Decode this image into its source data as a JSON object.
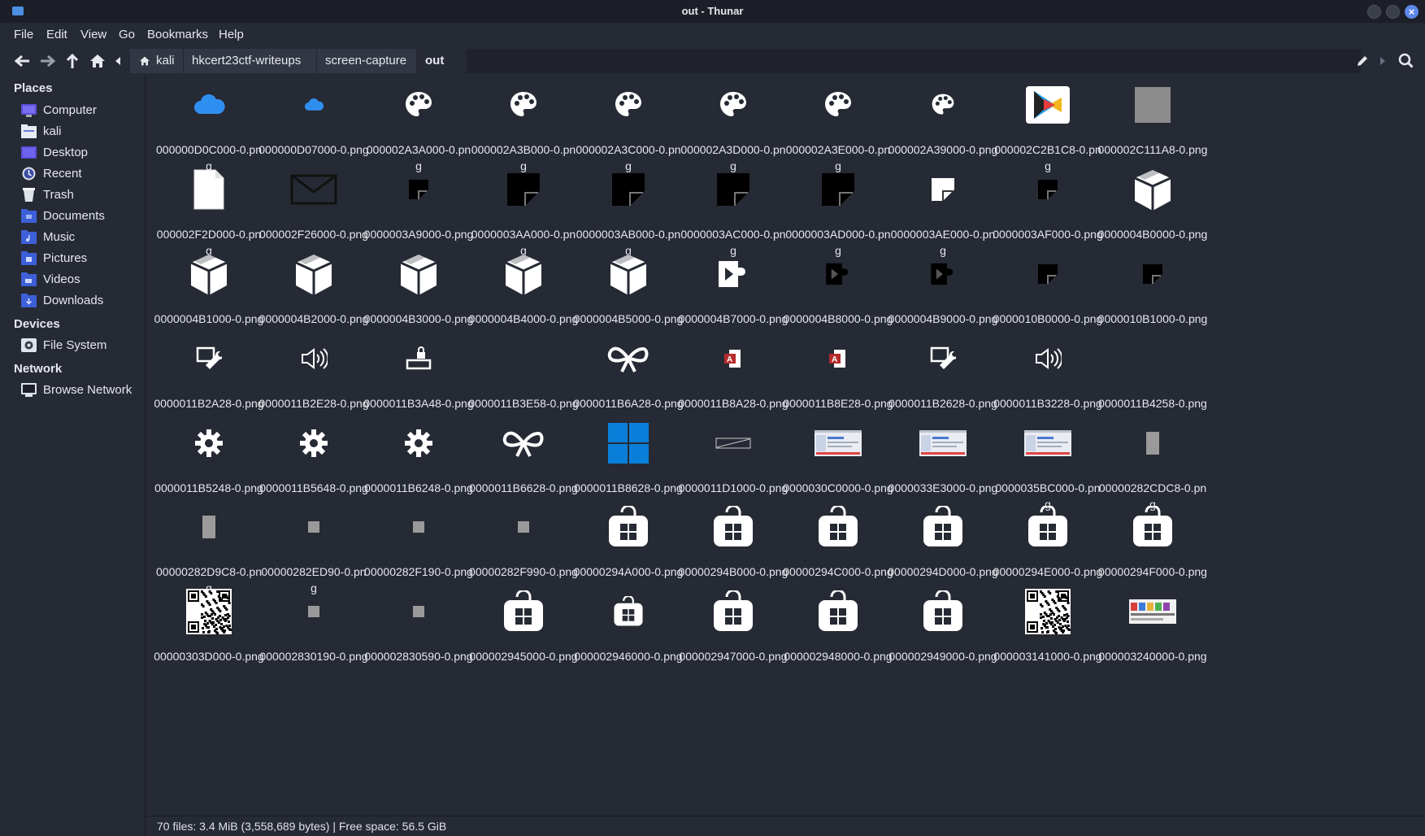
{
  "window": {
    "title": "out - Thunar"
  },
  "menu": [
    "File",
    "Edit",
    "View",
    "Go",
    "Bookmarks",
    "Help"
  ],
  "breadcrumbs": [
    "kali",
    "hkcert23ctf-writeups",
    "screen-capture",
    "out"
  ],
  "sidebar": {
    "places_label": "Places",
    "places": [
      {
        "label": "Computer",
        "icon": "computer-icon"
      },
      {
        "label": "kali",
        "icon": "home-folder-icon"
      },
      {
        "label": "Desktop",
        "icon": "desktop-icon"
      },
      {
        "label": "Recent",
        "icon": "recent-icon"
      },
      {
        "label": "Trash",
        "icon": "trash-icon"
      },
      {
        "label": "Documents",
        "icon": "documents-folder-icon"
      },
      {
        "label": "Music",
        "icon": "music-folder-icon"
      },
      {
        "label": "Pictures",
        "icon": "pictures-folder-icon"
      },
      {
        "label": "Videos",
        "icon": "videos-folder-icon"
      },
      {
        "label": "Downloads",
        "icon": "downloads-folder-icon"
      }
    ],
    "devices_label": "Devices",
    "devices": [
      {
        "label": "File System",
        "icon": "drive-icon"
      }
    ],
    "network_label": "Network",
    "network": [
      {
        "label": "Browse Network",
        "icon": "network-icon"
      }
    ]
  },
  "files": [
    {
      "name": "000000D0C000-0.png",
      "icon": "cloud-icon"
    },
    {
      "name": "000000D07000-0.png",
      "icon": "cloud-small-icon"
    },
    {
      "name": "000002A3A000-0.png",
      "icon": "palette-icon"
    },
    {
      "name": "000002A3B000-0.png",
      "icon": "palette-icon"
    },
    {
      "name": "000002A3C000-0.png",
      "icon": "palette-icon"
    },
    {
      "name": "000002A3D000-0.png",
      "icon": "palette-icon"
    },
    {
      "name": "000002A3E000-0.png",
      "icon": "palette-icon"
    },
    {
      "name": "000002A39000-0.png",
      "icon": "palette-small-icon"
    },
    {
      "name": "000002C2B1C8-0.png",
      "icon": "play-store-icon"
    },
    {
      "name": "000002C111A8-0.png",
      "icon": "gray-square-icon"
    },
    {
      "name": "000002F2D000-0.png",
      "icon": "blank-document-icon"
    },
    {
      "name": "000002F26000-0.png",
      "icon": "envelope-icon"
    },
    {
      "name": "0000003A9000-0.png",
      "icon": "note-small-icon"
    },
    {
      "name": "0000003AA000-0.png",
      "icon": "note-icon"
    },
    {
      "name": "0000003AB000-0.png",
      "icon": "note-icon"
    },
    {
      "name": "0000003AC000-0.png",
      "icon": "note-icon"
    },
    {
      "name": "0000003AD000-0.png",
      "icon": "note-icon"
    },
    {
      "name": "0000003AE000-0.png",
      "icon": "note-white-icon"
    },
    {
      "name": "0000003AF000-0.png",
      "icon": "note-small-icon"
    },
    {
      "name": "0000004B0000-0.png",
      "icon": "package-icon"
    },
    {
      "name": "0000004B1000-0.png",
      "icon": "package-icon"
    },
    {
      "name": "0000004B2000-0.png",
      "icon": "package-icon"
    },
    {
      "name": "0000004B3000-0.png",
      "icon": "package-icon"
    },
    {
      "name": "0000004B4000-0.png",
      "icon": "package-icon"
    },
    {
      "name": "0000004B5000-0.png",
      "icon": "package-icon"
    },
    {
      "name": "0000004B7000-0.png",
      "icon": "media-puzzle-icon"
    },
    {
      "name": "0000004B8000-0.png",
      "icon": "media-puzzle-dark-icon"
    },
    {
      "name": "0000004B9000-0.png",
      "icon": "media-puzzle-dark-icon"
    },
    {
      "name": "0000010B0000-0.png",
      "icon": "note-small-icon"
    },
    {
      "name": "0000010B1000-0.png",
      "icon": "note-small-icon"
    },
    {
      "name": "0000011B2A28-0.png",
      "icon": "settings-wrench-icon"
    },
    {
      "name": "0000011B2E28-0.png",
      "icon": "speaker-icon"
    },
    {
      "name": "0000011B3A48-0.png",
      "icon": "lock-keyboard-icon"
    },
    {
      "name": "0000011B3E58-0.png",
      "icon": "empty-icon"
    },
    {
      "name": "0000011B6A28-0.png",
      "icon": "accessibility-icon"
    },
    {
      "name": "0000011B8A28-0.png",
      "icon": "access-app-icon"
    },
    {
      "name": "0000011B8E28-0.png",
      "icon": "access-app-icon"
    },
    {
      "name": "0000011B2628-0.png",
      "icon": "settings-wrench-icon"
    },
    {
      "name": "0000011B3228-0.png",
      "icon": "speaker-icon"
    },
    {
      "name": "0000011B4258-0.png",
      "icon": "empty-icon"
    },
    {
      "name": "0000011B5248-0.png",
      "icon": "gear-icon"
    },
    {
      "name": "0000011B5648-0.png",
      "icon": "gear-icon"
    },
    {
      "name": "0000011B6248-0.png",
      "icon": "gear-icon"
    },
    {
      "name": "0000011B6628-0.png",
      "icon": "accessibility-icon"
    },
    {
      "name": "0000011B8628-0.png",
      "icon": "windows-logo-icon"
    },
    {
      "name": "0000011D1000-0.png",
      "icon": "slash-box-icon"
    },
    {
      "name": "0000030C0000-0.png",
      "icon": "screenshot-thumbnail-icon"
    },
    {
      "name": "0000033E3000-0.png",
      "icon": "screenshot-thumbnail-icon"
    },
    {
      "name": "0000035BC000-0.png",
      "icon": "screenshot-thumbnail-icon"
    },
    {
      "name": "00000282CDC8-0.png",
      "icon": "gray-bar-icon"
    },
    {
      "name": "00000282D9C8-0.png",
      "icon": "gray-bar-icon"
    },
    {
      "name": "00000282ED90-0.png",
      "icon": "gray-dot-icon"
    },
    {
      "name": "00000282F190-0.png",
      "icon": "gray-dot-icon"
    },
    {
      "name": "00000282F990-0.png",
      "icon": "gray-dot-icon"
    },
    {
      "name": "00000294A000-0.png",
      "icon": "store-bag-icon"
    },
    {
      "name": "00000294B000-0.png",
      "icon": "store-bag-icon"
    },
    {
      "name": "00000294C000-0.png",
      "icon": "store-bag-icon"
    },
    {
      "name": "00000294D000-0.png",
      "icon": "store-bag-icon"
    },
    {
      "name": "00000294E000-0.png",
      "icon": "store-bag-icon"
    },
    {
      "name": "00000294F000-0.png",
      "icon": "store-bag-icon"
    },
    {
      "name": "00000303D000-0.png",
      "icon": "qr-code-icon"
    },
    {
      "name": "000002830190-0.png",
      "icon": "gray-dot-icon"
    },
    {
      "name": "000002830590-0.png",
      "icon": "gray-dot-icon"
    },
    {
      "name": "000002945000-0.png",
      "icon": "store-bag-icon"
    },
    {
      "name": "000002946000-0.png",
      "icon": "store-bag-small-icon"
    },
    {
      "name": "000002947000-0.png",
      "icon": "store-bag-icon"
    },
    {
      "name": "000002948000-0.png",
      "icon": "store-bag-icon"
    },
    {
      "name": "000002949000-0.png",
      "icon": "store-bag-icon"
    },
    {
      "name": "000003141000-0.png",
      "icon": "qr-code-icon"
    },
    {
      "name": "000003240000-0.png",
      "icon": "thumbnail-strip-icon"
    }
  ],
  "status": "70 files: 3.4 MiB (3,558,689 bytes)  |  Free space: 56.5 GiB"
}
